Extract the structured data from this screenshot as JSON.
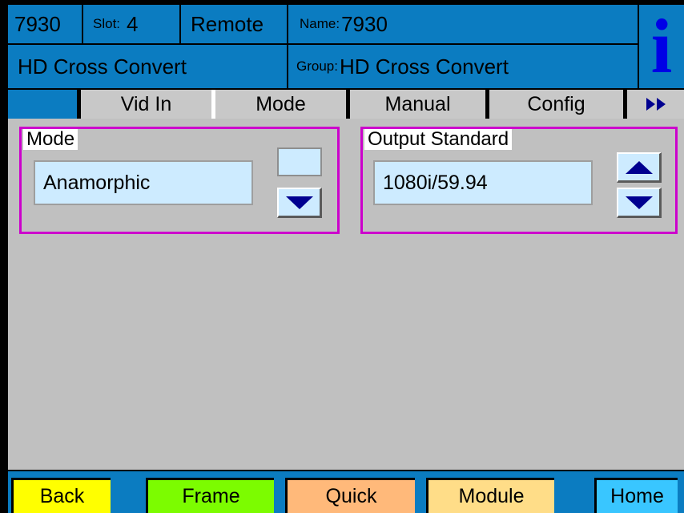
{
  "header": {
    "device": "7930",
    "slot_label": "Slot:",
    "slot_value": "4",
    "control_mode": "Remote",
    "name_label": "Name:",
    "name_value": "7930",
    "product": "HD Cross Convert",
    "group_label": "Group:",
    "group_value": "HD Cross Convert",
    "info_glyph": "i"
  },
  "tabs": [
    {
      "label": "Vid In",
      "active": false
    },
    {
      "label": "Mode",
      "active": true
    },
    {
      "label": "Manual",
      "active": false
    },
    {
      "label": "Config",
      "active": false
    }
  ],
  "mode_group": {
    "legend": "Mode",
    "value": "Anamorphic"
  },
  "output_group": {
    "legend": "Output Standard",
    "value": "1080i/59.94"
  },
  "footer": {
    "back": {
      "label": "Back",
      "color": "#FFFF00"
    },
    "frame": {
      "label": "Frame",
      "color": "#7CFC00"
    },
    "quick": {
      "label": "Quick",
      "color": "#FFB97A"
    },
    "module": {
      "label": "Module",
      "color": "#FFDD88"
    },
    "home": {
      "label": "Home",
      "color": "#39C6FF"
    }
  },
  "colors": {
    "header_bg": "#0B7CC1",
    "content_bg": "#C0C0C0",
    "group_border": "#CC00CC",
    "field_bg": "#CDEBFF",
    "arrow": "#000090",
    "info": "#0000E6"
  }
}
